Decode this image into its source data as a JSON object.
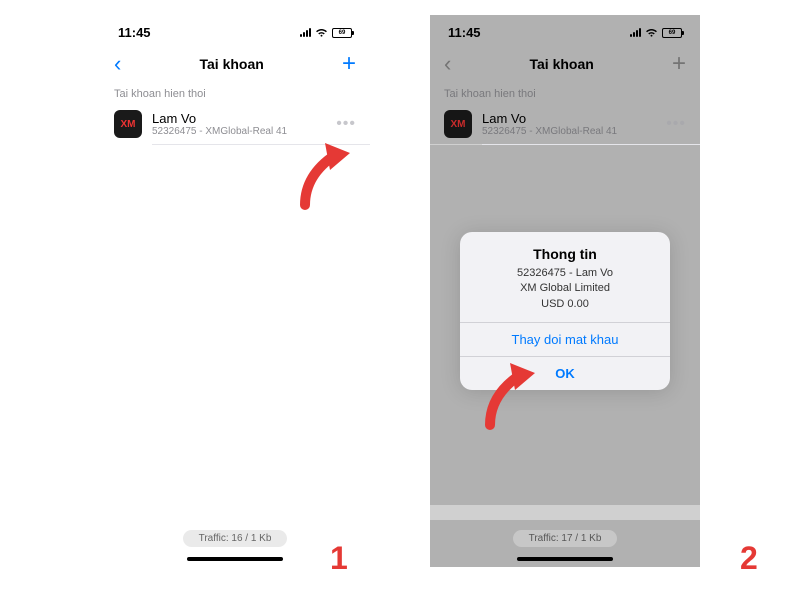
{
  "status": {
    "time": "11:45",
    "battery": "69"
  },
  "nav": {
    "title": "Tai khoan",
    "back_glyph": "‹",
    "add_glyph": "+"
  },
  "section": {
    "header": "Tai khoan hien thoi"
  },
  "account": {
    "icon_text": "XM",
    "name": "Lam Vo",
    "subtitle": "52326475 - XMGlobal-Real 41",
    "more_glyph": "•••"
  },
  "footer": {
    "traffic1": "Traffic: 16 / 1 Kb",
    "traffic2": "Traffic: 17 / 1 Kb"
  },
  "dialog": {
    "title": "Thong tin",
    "line1": "52326475 - Lam Vo",
    "line2": "XM Global Limited",
    "line3": "USD 0.00",
    "change_pw": "Thay doi mat khau",
    "ok": "OK"
  },
  "steps": {
    "one": "1",
    "two": "2"
  }
}
